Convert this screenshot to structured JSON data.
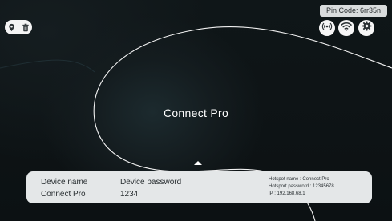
{
  "header": {
    "pin_code": "Pin Code: 6rr35n"
  },
  "top_left_icons": [
    "location-pin-icon",
    "trash-icon"
  ],
  "top_right_icons": [
    "hotspot-icon",
    "wifi-icon",
    "settings-icon"
  ],
  "main": {
    "title": "Connect Pro"
  },
  "device_panel": {
    "name_label": "Device name",
    "name_value": "Connect Pro",
    "password_label": "Device password",
    "password_value": "1234",
    "hotspot_name": "Hotspot name : Connect Pro",
    "hotspot_password": "Hotsport password : 12345678",
    "ip": "IP : 192.168.68.1"
  },
  "colors": {
    "background": "#0e1416",
    "panel": "#e4e7e8",
    "pill": "#f4f4f4"
  }
}
